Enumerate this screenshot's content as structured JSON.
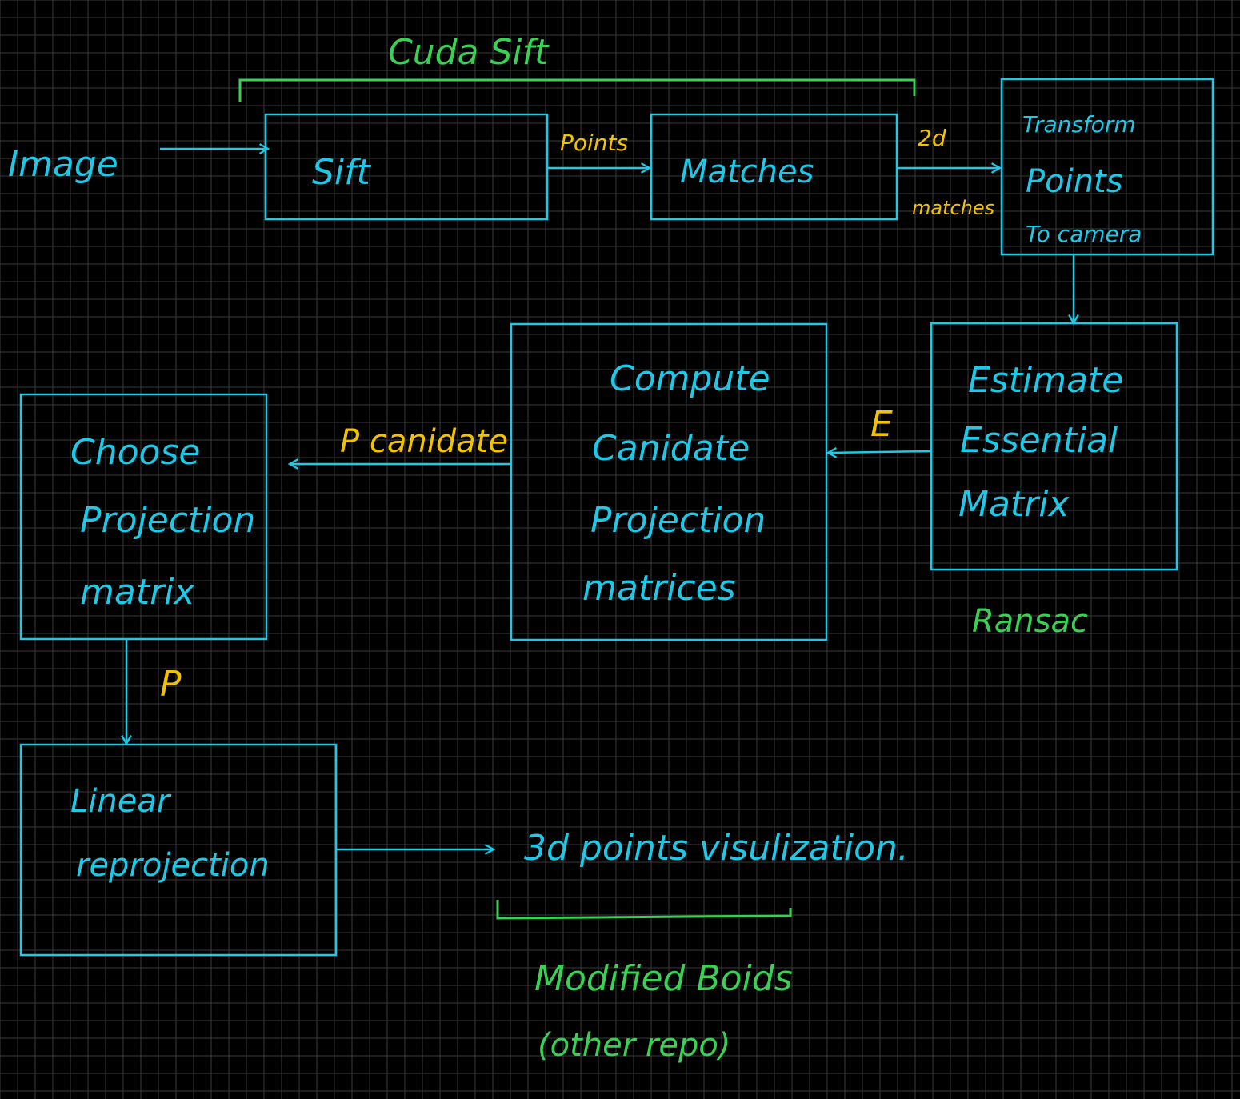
{
  "colors": {
    "background": "#000000",
    "grid": "#3a3a3a",
    "cyan": "#1ec8e6",
    "green": "#3ccf55",
    "yellow": "#f2c200"
  },
  "labels": {
    "cuda_sift": "Cuda Sift",
    "image": "Image",
    "sift": "Sift",
    "points": "Points",
    "matches": "Matches",
    "matches_2d_top": "2d",
    "matches_2d_bottom": "matches",
    "transform_line1": "Transform",
    "transform_line2": "Points",
    "transform_line3": "To camera",
    "estimate_line1": "Estimate",
    "estimate_line2": "Essential",
    "estimate_line3": "Matrix",
    "ransac": "Ransac",
    "e_label": "E",
    "compute_line1": "Compute",
    "compute_line2": "Canidate",
    "compute_line3": "Projection",
    "compute_line4": "matrices",
    "p_candidate": "P canidate",
    "choose_line1": "Choose",
    "choose_line2": "Projection",
    "choose_line3": "matrix",
    "p_label": "P",
    "linear_line1": "Linear",
    "linear_line2": "reprojection",
    "points_3d": "3d points visulization.",
    "modified_boids": "Modified Boids",
    "other_repo": "(other repo)"
  }
}
